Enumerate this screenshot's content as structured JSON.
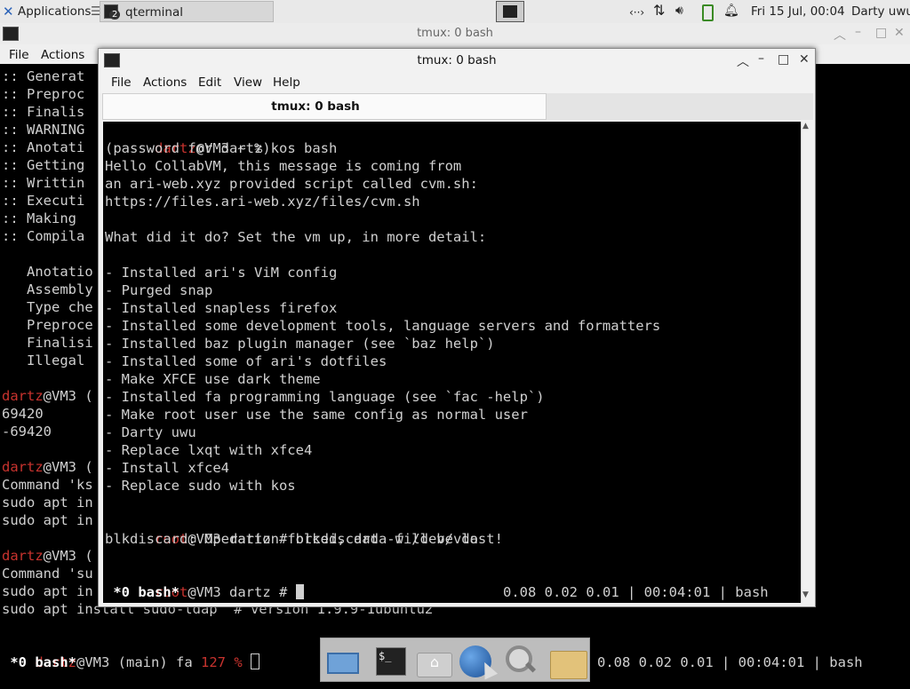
{
  "top_panel": {
    "applications_label": "Applications",
    "task_label": "qterminal",
    "task_badge": "2",
    "datetime": "Fri 15 Jul, 00:04",
    "user": "Darty uwu"
  },
  "back_window": {
    "title": "tmux: 0 bash",
    "menu": [
      "File",
      "Actions",
      "Edit",
      "View",
      "Help"
    ],
    "lines": [
      ":: Generat",
      ":: Preproc",
      ":: Finalis",
      ":: WARNING",
      ":: Anotati",
      ":: Getting",
      ":: Writtin",
      ":: Executi",
      ":: Making",
      ":: Compila",
      "",
      "   Anotatio",
      "   Assembly",
      "   Type che",
      "   Preproce",
      "   Finalisi",
      "   Illegal",
      "",
      "dartz@VM3 (",
      "69420",
      "-69420",
      "",
      "dartz@VM3 (",
      "Command 'ks",
      "sudo apt in",
      "sudo apt in",
      "",
      "dartz@VM3 (",
      "Command 'su",
      "sudo apt in",
      "sudo apt install sudo-ldap  # version 1.9.9-1ubuntu2"
    ],
    "prompt": {
      "user": "dartz",
      "rest": "@VM3 (main) fa ",
      "code": "127",
      "sym": " %"
    },
    "status_left": " *0 bash*",
    "status_right": "0.08 0.02 0.01 | 00:04:01 | bash"
  },
  "front_window": {
    "title": "tmux: 0 bash",
    "menu": [
      "File",
      "Actions",
      "Edit",
      "View",
      "Help"
    ],
    "tab_label": "tmux: 0 bash",
    "first_prompt": {
      "user": "dartz",
      "rest": "@VM3 ~ % kos bash"
    },
    "lines": [
      "(password for dartz)",
      "Hello CollabVM, this message is coming from",
      "an ari-web.xyz provided script called cvm.sh:",
      "https://files.ari-web.xyz/files/cvm.sh",
      "",
      "What did it do? Set the vm up, in more detail:",
      "",
      "- Installed ari's ViM config",
      "- Purged snap",
      "- Installed snapless firefox",
      "- Installed some development tools, language servers and formatters",
      "- Installed baz plugin manager (see `baz help`)",
      "- Installed some of ari's dotfiles",
      "- Make XFCE use dark theme",
      "- Installed fa programming language (see `fac -help`)",
      "- Make root user use the same config as normal user",
      "- Darty uwu",
      "- Replace lxqt with xfce4",
      "- Install xfce4",
      "- Replace sudo with kos",
      ""
    ],
    "cmd_prompt": {
      "user": "root",
      "rest": "@VM3 dartz # blkdiscard -f /dev/vda"
    },
    "cmd_output": "blkdiscard: Operation forced, data will be lost!",
    "final_prompt": {
      "user": "root",
      "rest": "@VM3 dartz # "
    },
    "status_left": " *0 bash*",
    "status_right": "0.08 0.02 0.01 | 00:04:01 | bash"
  },
  "dock": {
    "icons": [
      "show-desktop-icon",
      "terminal-icon",
      "home-folder-icon",
      "web-browser-icon",
      "search-icon",
      "folder-icon"
    ]
  },
  "colors": {
    "prompt_user": "#c8332e",
    "terminal_fg": "#d0d0d0",
    "terminal_bg": "#000000"
  }
}
